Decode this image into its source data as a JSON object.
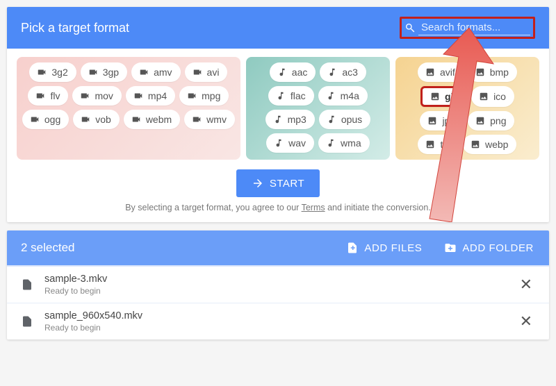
{
  "header": {
    "title": "Pick a target format",
    "search_placeholder": "Search formats..."
  },
  "groups": {
    "video": [
      "3g2",
      "3gp",
      "amv",
      "avi",
      "flv",
      "mov",
      "mp4",
      "mpg",
      "ogg",
      "vob",
      "webm",
      "wmv"
    ],
    "audio": [
      "aac",
      "ac3",
      "flac",
      "m4a",
      "mp3",
      "opus",
      "wav",
      "wma"
    ],
    "image": [
      "avif",
      "bmp",
      "gif",
      "ico",
      "jpg",
      "png",
      "tiff",
      "webp"
    ]
  },
  "image_highlight": "gif",
  "start": {
    "label": "START"
  },
  "terms": {
    "prefix": "By selecting a target format, you agree to our ",
    "link": "Terms",
    "suffix": " and initiate the conversion."
  },
  "selection": {
    "count_label": "2 selected",
    "add_files": "ADD FILES",
    "add_folder": "ADD FOLDER"
  },
  "files": [
    {
      "name": "sample-3.mkv",
      "status": "Ready to begin"
    },
    {
      "name": "sample_960x540.mkv",
      "status": "Ready to begin"
    }
  ],
  "icons": {
    "video": "video-icon",
    "audio": "audio-icon",
    "image": "image-icon"
  }
}
